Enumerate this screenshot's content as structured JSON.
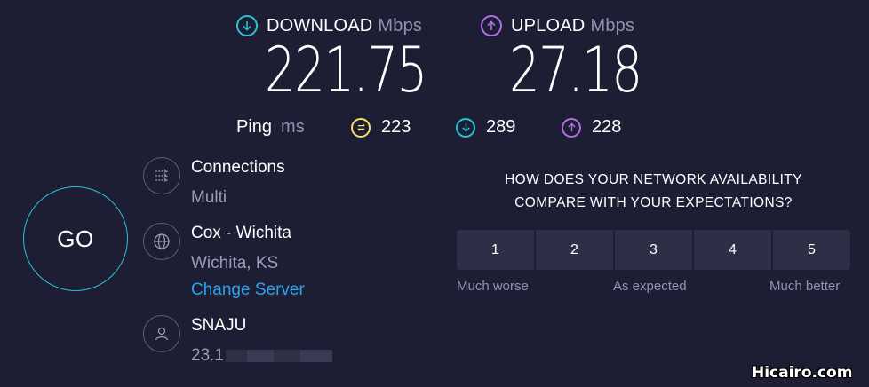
{
  "download": {
    "label": "DOWNLOAD",
    "unit": "Mbps",
    "value": "221.75"
  },
  "upload": {
    "label": "UPLOAD",
    "unit": "Mbps",
    "value": "27.18"
  },
  "ping": {
    "label": "Ping",
    "unit": "ms",
    "idle": "223",
    "down": "289",
    "up": "228"
  },
  "go": {
    "label": "GO"
  },
  "connections": {
    "title": "Connections",
    "value": "Multi"
  },
  "server": {
    "title": "Cox - Wichita",
    "location": "Wichita, KS",
    "change_label": "Change Server"
  },
  "user": {
    "title": "SNAJU",
    "ip_prefix": "23.1"
  },
  "survey": {
    "question_line1": "HOW DOES YOUR NETWORK AVAILABILITY",
    "question_line2": "COMPARE WITH YOUR EXPECTATIONS?",
    "options": [
      "1",
      "2",
      "3",
      "4",
      "5"
    ],
    "low_label": "Much worse",
    "mid_label": "As expected",
    "high_label": "Much better"
  },
  "watermark": "Hicairo.com",
  "colors": {
    "background": "#1d1e33",
    "download_accent": "#29c2d6",
    "upload_accent": "#b46ee8",
    "ping_accent": "#f3e06c",
    "link": "#2aa4ee"
  },
  "icons": {
    "download": "arrow-down-circle-icon",
    "upload": "arrow-up-circle-icon",
    "ping": "ping-idle-icon",
    "connections": "connections-arrows-icon",
    "server": "globe-icon",
    "user": "user-icon"
  }
}
